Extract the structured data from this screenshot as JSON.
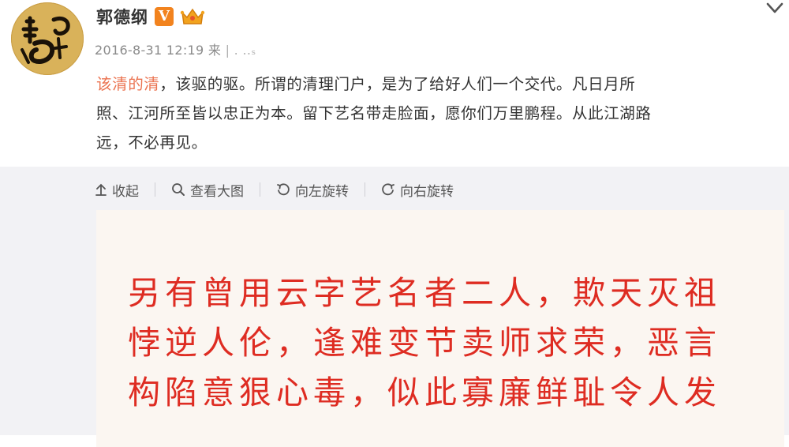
{
  "post": {
    "author": "郭德纲",
    "badge_v": "V",
    "timestamp": "2016-8-31 12:19",
    "source_prefix": "来",
    "text_highlight": "该清的清",
    "text_lines": [
      "，该驱的驱。所谓的清理门户，是为了给好人们一个交代。凡日月所",
      "照、江河所至皆以忠正为本。留下艺名带走脸面，愿你们万里鹏程。从此江湖路",
      "远，不必再见。"
    ]
  },
  "toolbar": {
    "collapse": "收起",
    "view_large": "查看大图",
    "rotate_left": "向左旋转",
    "rotate_right": "向右旋转"
  },
  "image": {
    "lines": [
      "另有曾用云字艺名者二人，欺天灭祖",
      "悖逆人伦，逢难变节卖师求荣，恶言",
      "构陷意狠心毒，似此寡廉鲜耻令人发"
    ]
  },
  "icons": [
    "avatar-calligraphy",
    "vip-crown-icon",
    "chevron-down-icon",
    "arrow-up-icon",
    "search-icon",
    "rotate-left-icon",
    "rotate-right-icon"
  ],
  "colors": {
    "highlight_text": "#eb7350",
    "image_text": "#de2c22",
    "badge_v": "#f2831e"
  }
}
